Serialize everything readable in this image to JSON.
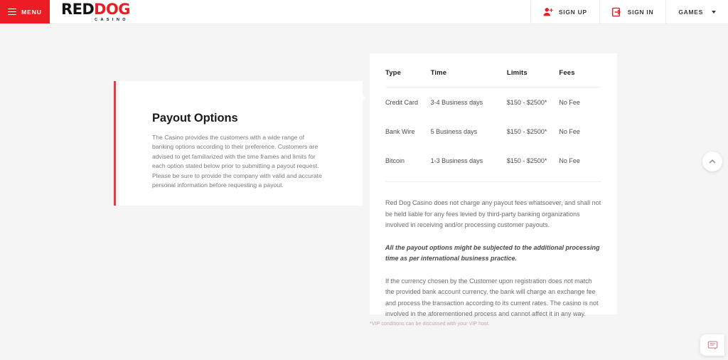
{
  "header": {
    "menu_label": "MENU",
    "logo": {
      "part1": "RED",
      "part2": "DOG",
      "subtitle": "CASINO"
    },
    "sign_up_label": "SIGN UP",
    "sign_in_label": "SIGN IN",
    "games_label": "GAMES"
  },
  "left_card": {
    "title": "Payout Options",
    "body": "The Casino provides the customers with a wide range of banking options according to their preference. Customers are advised to get familiarized with the time frames and limits for each option stated below prior to submitting a payout request. Please be sure to provide the company with valid and accurate personal information before requesting a payout."
  },
  "table": {
    "columns": [
      "Type",
      "Time",
      "Limits",
      "Fees"
    ],
    "rows": [
      {
        "type": "Credit Card",
        "time": "3-4 Business days",
        "limits": "$150 - $2500*",
        "fees": "No Fee"
      },
      {
        "type": "Bank Wire",
        "time": "5 Business days",
        "limits": "$150 - $2500*",
        "fees": "No Fee"
      },
      {
        "type": "Bitcoin",
        "time": "1-3 Business days",
        "limits": "$150 - $2500*",
        "fees": "No Fee"
      }
    ]
  },
  "notes": [
    "Red Dog Casino does not charge any payout fees whatsoever, and shall not be held liable for any fees levied by third-party banking organizations involved in receiving and/or processing customer payouts.",
    "All the payout options might be subjected to the additional processing time as per international business practice.",
    "If the currency chosen by the Customer upon registration does not match the provided bank account currency, the bank will charge an exchange fee and process the transaction according to its current rates. The casino is not involved in the aforementioned process and cannot affect it in any way."
  ],
  "footnote": "*VIP conditions can be discussed with your VIP host.",
  "colors": {
    "brand_red": "#ec1c24",
    "accent_bar": "#e23b49",
    "page_background": "#f5f5f5",
    "panel_background": "#ffffff"
  }
}
